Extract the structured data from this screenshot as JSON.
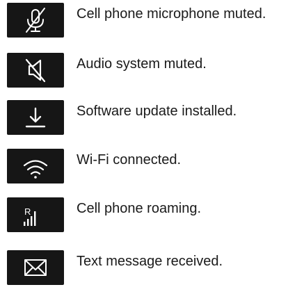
{
  "indicators": [
    {
      "icon": "microphone-muted-icon",
      "label": "Cell phone microphone muted."
    },
    {
      "icon": "speaker-muted-icon",
      "label": "Audio system muted."
    },
    {
      "icon": "download-icon",
      "label": "Software update installed."
    },
    {
      "icon": "wifi-icon",
      "label": "Wi-Fi connected."
    },
    {
      "icon": "roaming-signal-icon",
      "label": "Cell phone roaming.",
      "glyph": "R"
    },
    {
      "icon": "envelope-icon",
      "label": "Text message received."
    }
  ],
  "colors": {
    "icon_background": "#161616",
    "icon_foreground": "#ffffff",
    "text": "#1a1a1a"
  }
}
